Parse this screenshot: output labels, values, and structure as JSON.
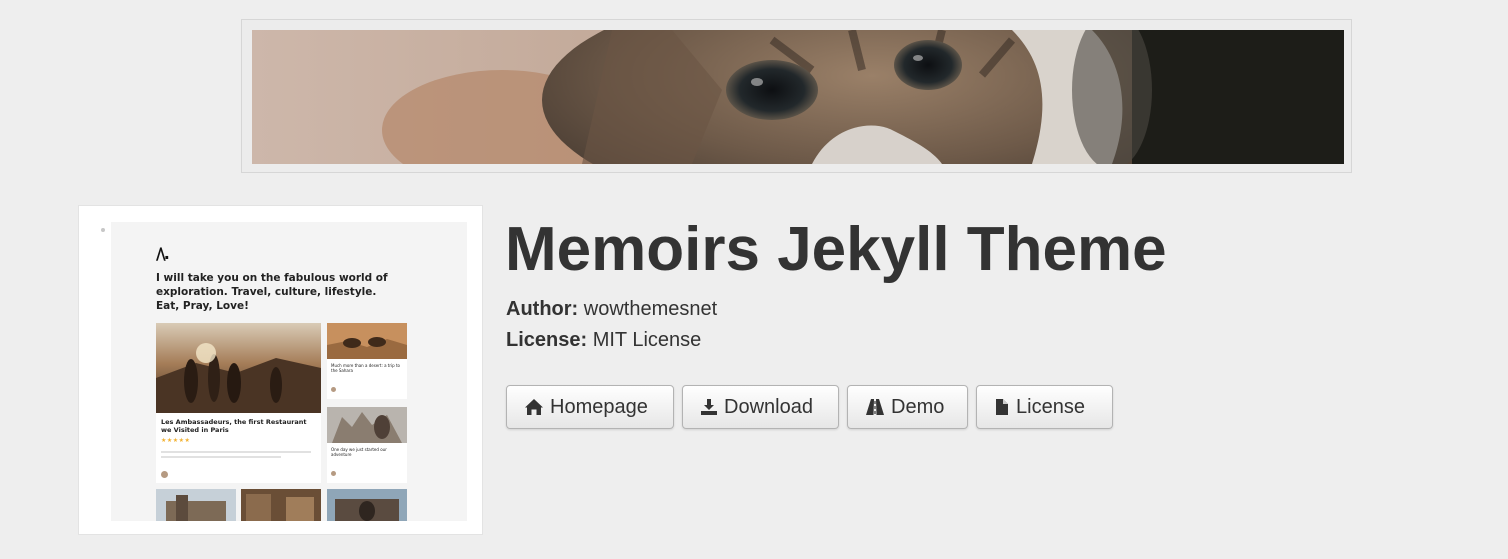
{
  "banner": {
    "image_alt": "kitten close-up banner"
  },
  "thumbnail": {
    "logo_text": "/\\.",
    "tagline": "I will take you on the fabulous world of exploration. Travel, culture, lifestyle. Eat, Pray, Love!",
    "featured_title": "Les Ambassadeurs, the first Restaurant we Visited in Paris",
    "side_card_1_title": "Much more than a desert: a trip to the Sahara",
    "side_card_2_title": "One day we just started our adventure",
    "stars": "★★★★★"
  },
  "theme": {
    "title": "Memoirs Jekyll Theme",
    "author_label": "Author:",
    "author_value": "wowthemesnet",
    "license_label": "License:",
    "license_value": "MIT License"
  },
  "buttons": [
    {
      "label": "Homepage",
      "icon": "home-icon"
    },
    {
      "label": "Download",
      "icon": "download-icon"
    },
    {
      "label": "Demo",
      "icon": "road-icon"
    },
    {
      "label": "License",
      "icon": "file-icon"
    }
  ]
}
